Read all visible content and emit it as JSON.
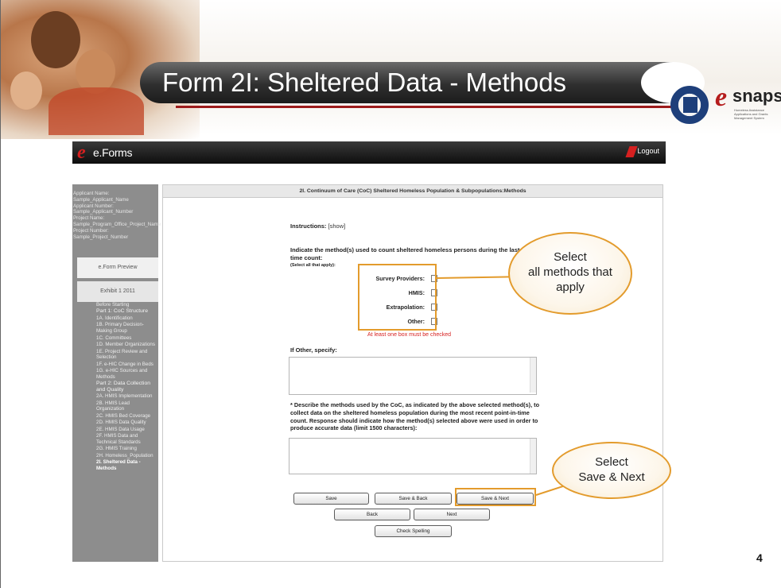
{
  "slide": {
    "title": "Form 2I: Sheltered Data - Methods",
    "page_number": "4",
    "logo_text": "snaps",
    "logo_tagline": "Homeless Assistance Applications and Grants Management System"
  },
  "eforms": {
    "app_name": "e.Forms",
    "logout_label": "Logout"
  },
  "sidebar": {
    "applicant_info": [
      "Applicant Name:",
      "Sample_Applicant_Name",
      "Applicant Number:",
      "Sample_Applicant_Number",
      "Project Name:",
      "Sample_Program_Office_Project_Name",
      "Project Number:",
      "Sample_Project_Number"
    ],
    "preview_label": "e.Form Preview",
    "exhibit_label": "Exhibit 1 2011",
    "nav_items": [
      "Before Starting",
      "Part 1: CoC Structure",
      "1A. Identification",
      "1B. Primary Decision-Making Group",
      "1C. Committees",
      "1D. Member Organizations",
      "1E. Project Review and Selection",
      "1F. e-HIC Change in Beds",
      "1G. e-HIC Sources and Methods",
      "Part 2: Data Collection and Quality",
      "2A. HMIS Implementation",
      "2B. HMIS Lead Organization",
      "2C. HMIS Bed Coverage",
      "2D. HMIS Data Quality",
      "2E. HMIS Data Usage",
      "2F. HMIS Data and Technical Standards",
      "2G. HMIS Training",
      "2H. Homeless_Population",
      "2I. Sheltered Data - Methods"
    ]
  },
  "main": {
    "header": "2I. Continuum of Care (CoC) Sheltered Homeless Population & Subpopulations:Methods",
    "instructions_label": "Instructions:",
    "instructions_link": "[show]",
    "question1": "Indicate the method(s) used to count sheltered homeless persons during the last point-in-time count:",
    "question1_sub": "(Select all that apply):",
    "checkboxes": [
      {
        "label": "Survey Providers:",
        "checked": false
      },
      {
        "label": "HMIS:",
        "checked": false
      },
      {
        "label": "Extrapolation:",
        "checked": false
      },
      {
        "label": "Other:",
        "checked": false
      }
    ],
    "error_text": "At least one box must be checked",
    "other_label": "If Other, specify:",
    "other_value": "",
    "question2": "* Describe the methods used by the CoC, as indicated by the above selected method(s), to collect data on the sheltered homeless population during the most recent point-in-time count. Response should indicate how the method(s) selected above were used in order to produce accurate data (limit 1500 characters):",
    "question2_value": "",
    "buttons": {
      "save": "Save",
      "save_back": "Save & Back",
      "save_next": "Save & Next",
      "back": "Back",
      "next": "Next",
      "check_spelling": "Check Spelling"
    }
  },
  "callouts": {
    "methods": "Select all methods that apply",
    "methods_line1": "Select",
    "methods_line2": "all methods that",
    "methods_line3": "apply",
    "save_next_line1": "Select",
    "save_next_line2": "Save & Next"
  },
  "colors": {
    "callout_border": "#e39b2c",
    "error_red": "#d61f1f",
    "sidebar_bg": "#8d8d8d",
    "title_bar": "#2f2f2f"
  }
}
